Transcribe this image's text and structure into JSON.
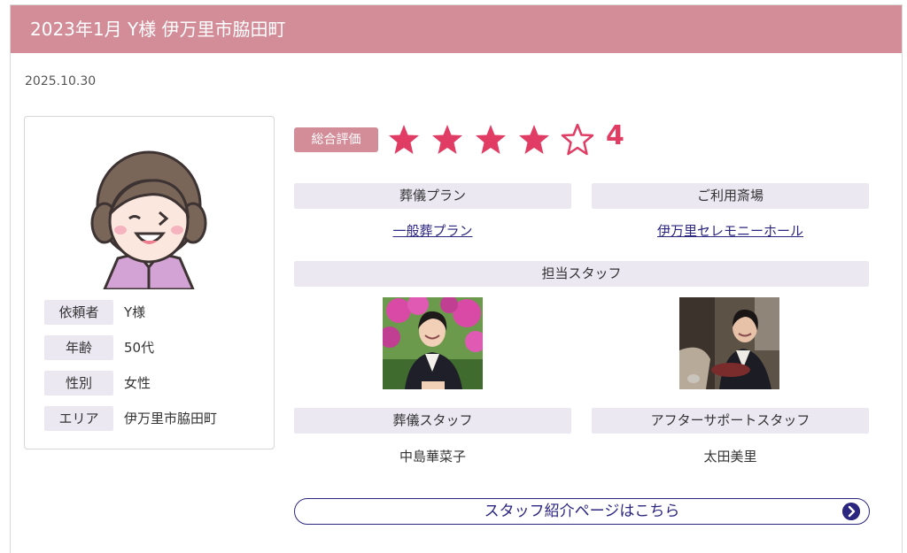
{
  "header": {
    "title": "2023年1月 Y様 伊万里市脇田町"
  },
  "date": "2025.10.30",
  "profile": {
    "rows": [
      {
        "label": "依頼者",
        "value": "Y様"
      },
      {
        "label": "年齢",
        "value": "50代"
      },
      {
        "label": "性別",
        "value": "女性"
      },
      {
        "label": "エリア",
        "value": "伊万里市脇田町"
      }
    ]
  },
  "rating": {
    "label": "総合評価",
    "value": "4",
    "max": 5,
    "filled": 4,
    "star_color": "#e03c64"
  },
  "plan": {
    "label": "葬儀プラン",
    "value": "一般葬プラン"
  },
  "venue": {
    "label": "ご利用斎場",
    "value": "伊万里セレモニーホール"
  },
  "staff": {
    "label": "担当スタッフ",
    "members": [
      {
        "role": "葬儀スタッフ",
        "name": "中島華菜子"
      },
      {
        "role": "アフターサポートスタッフ",
        "name": "太田美里"
      }
    ]
  },
  "staff_button": {
    "label": "スタッフ紹介ページはこちら"
  },
  "colors": {
    "header": "#d28d99",
    "label_bg": "#ebe8f2",
    "link": "#2b2680"
  }
}
